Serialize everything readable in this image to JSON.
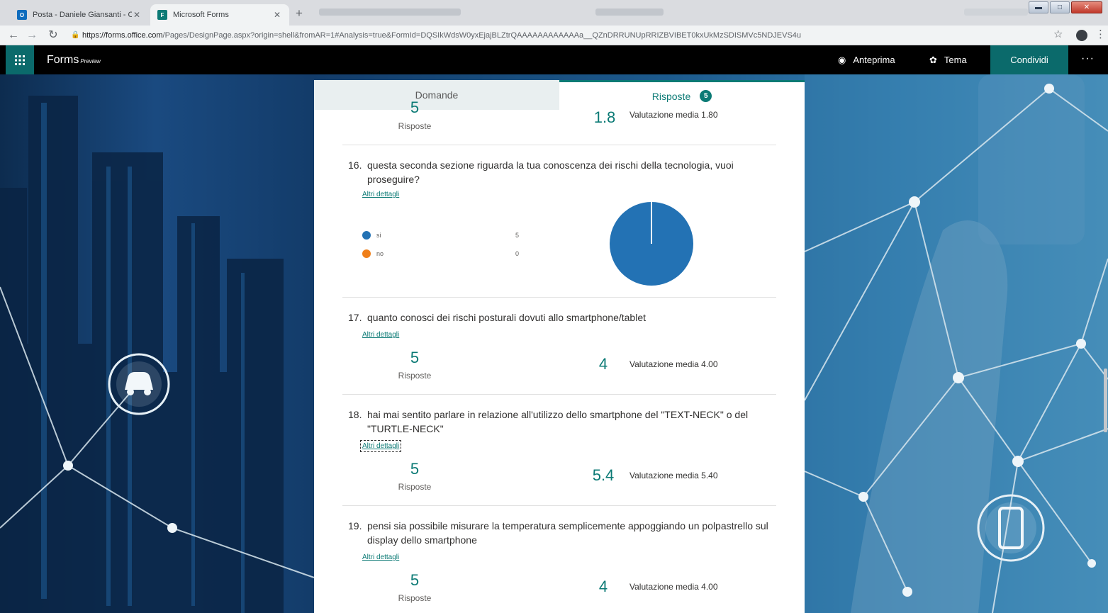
{
  "browser": {
    "tabs": [
      {
        "title": "Posta - Daniele Giansanti - Outlo",
        "icon": "outlook-icon"
      },
      {
        "title": "Microsoft Forms",
        "icon": "forms-icon"
      }
    ],
    "url_host": "https://forms.office.com",
    "url_path": "/Pages/DesignPage.aspx?origin=shell&fromAR=1#Analysis=true&FormId=DQSIkWdsW0yxEjajBLZtrQAAAAAAAAAAAAa__QZnDRRUNUpRRIZBVIBET0kxUkMzSDISMVc5NDJEVS4u"
  },
  "appbar": {
    "brand": "Forms",
    "brand_preview": "Preview",
    "preview_label": "Anteprima",
    "theme_label": "Tema",
    "share_label": "Condividi",
    "more_label": "···"
  },
  "panel": {
    "tab_questions": "Domande",
    "tab_responses": "Risposte",
    "responses_badge": "5"
  },
  "questions": {
    "q15": {
      "responses_count": "5",
      "responses_label": "Risposte",
      "average_value": "1.8",
      "average_label": "Valutazione media 1.80"
    },
    "q16": {
      "number": "16.",
      "text_line1": "questa seconda sezione riguarda la tua conoscenza dei rischi della tecnologia, vuoi",
      "text_line2": "proseguire?",
      "details_link": "Altri dettagli",
      "options": [
        {
          "label": "si",
          "count": "5",
          "color": "#2372b4"
        },
        {
          "label": "no",
          "count": "0",
          "color": "#ef7f1a"
        }
      ]
    },
    "q17": {
      "number": "17.",
      "text_line1": "quanto conosci dei rischi posturali dovuti allo smartphone/tablet",
      "details_link": "Altri dettagli",
      "responses_count": "5",
      "responses_label": "Risposte",
      "average_value": "4",
      "average_label": "Valutazione media 4.00"
    },
    "q18": {
      "number": "18.",
      "text_line1": "hai mai sentito parlare in relazione all'utilizzo dello smartphone del \"TEXT-NECK\" o del",
      "text_line2": "\"TURTLE-NECK\"",
      "details_link": "Altri dettagli",
      "responses_count": "5",
      "responses_label": "Risposte",
      "average_value": "5.4",
      "average_label": "Valutazione media 5.40"
    },
    "q19": {
      "number": "19.",
      "text_line1": "pensi sia possibile misurare la temperatura semplicemente appoggiando un polpastrello sul",
      "text_line2": "display dello smartphone",
      "details_link": "Altri dettagli",
      "responses_count": "5",
      "responses_label": "Risposte",
      "average_value": "4",
      "average_label": "Valutazione media 4.00"
    }
  },
  "colors": {
    "forms_teal": "#0b7a75",
    "pie_si": "#2372b4",
    "pie_no": "#ef7f1a"
  }
}
